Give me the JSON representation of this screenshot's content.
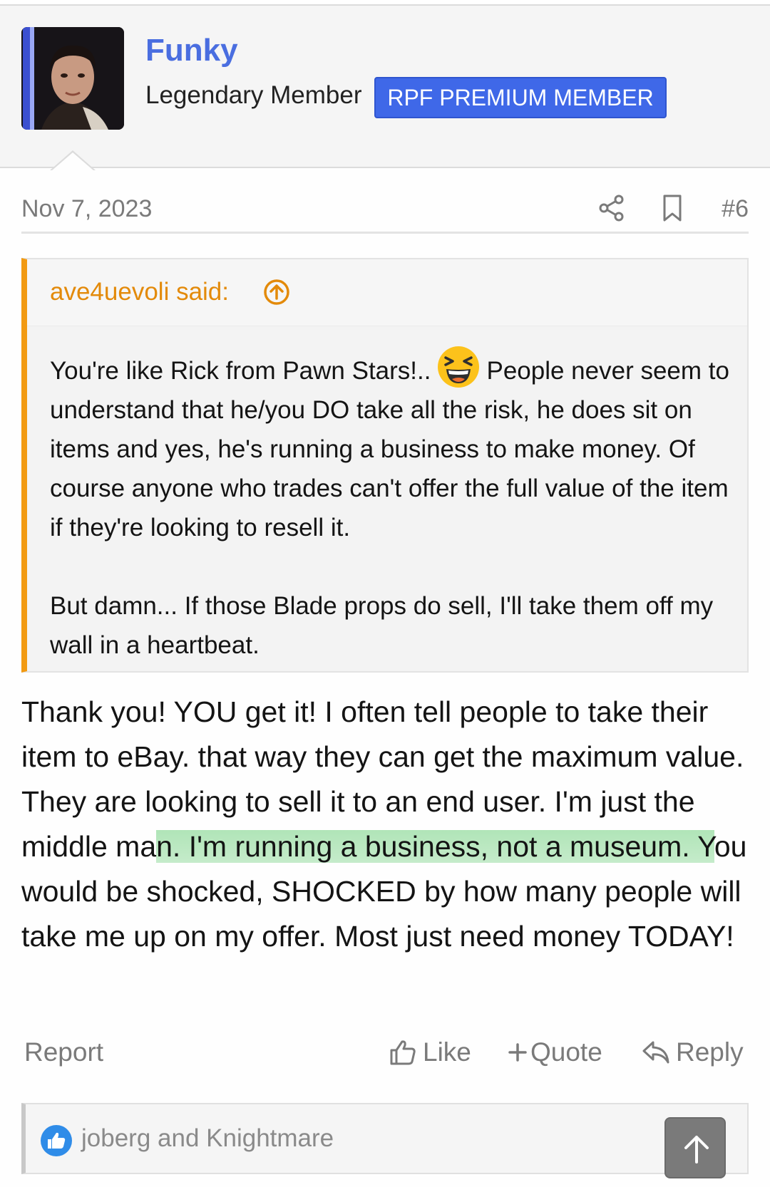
{
  "user": {
    "name": "Funky",
    "title": "Legendary Member",
    "badge": "RPF PREMIUM MEMBER"
  },
  "post": {
    "date": "Nov 7, 2023",
    "number": "#6"
  },
  "quote": {
    "author_line": "ave4uevoli said:",
    "text_before_emoji": "You're like Rick from Pawn Stars!..",
    "text_after_emoji": "People never seem to understand that he/you DO take all the risk, he does sit on items and yes, he's running a business to make money. Of course anyone who trades can't offer the full value of the item if they're looking to resell it.",
    "paragraph_2": "But damn... If those Blade props do sell, I'll take them off my wall in a heartbeat."
  },
  "message": {
    "text_before_highlight": "Thank you! YOU get it! I often tell people to take their item to eBay. that way they can get the maximum value. They are looking to sell it to an end user. I'm just the middle ma",
    "highlighted": "n. I'm running a business, not a museum. Y",
    "text_after_highlight": "ou would be shocked, SHOCKED by how many people will take me up on my offer. Most just need money TODAY!"
  },
  "actions": {
    "report": "Report",
    "like": "Like",
    "quote": "Quote",
    "reply": "Reply"
  },
  "reactions": {
    "users": "joberg and Knightmare"
  },
  "colors": {
    "username": "#4a6ee0",
    "badge_bg": "#3f68e8",
    "quote_accent": "#f29a12",
    "highlight": "#96dca0"
  },
  "icons": {
    "share": "share-icon",
    "bookmark": "bookmark-icon",
    "quote_goto": "arrow-up-circle-icon",
    "like": "thumbs-up-icon",
    "quote": "plus-icon",
    "reply": "reply-arrow-icon",
    "reaction": "like-reaction-icon",
    "scroll_top": "arrow-up-icon",
    "emoji": "laughing-emoji-icon"
  }
}
